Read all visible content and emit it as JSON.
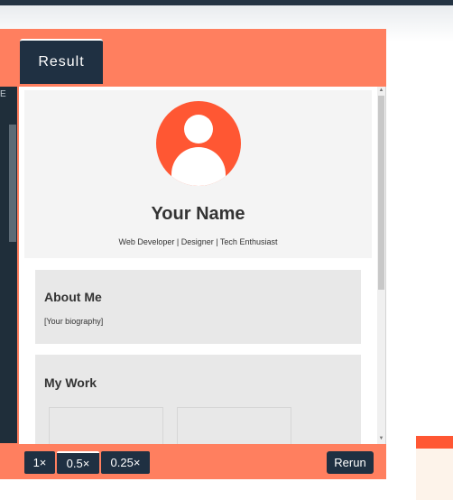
{
  "result_tab": {
    "label": "Result"
  },
  "left_panel": {
    "label": "E"
  },
  "profile": {
    "name": "Your Name",
    "tagline": "Web Developer | Designer | Tech Enthusiast",
    "avatar_icon": "user-icon",
    "accent_color": "#ff5733"
  },
  "about": {
    "title": "About Me",
    "text": "[Your biography]"
  },
  "work": {
    "title": "My Work"
  },
  "zoom": {
    "options": [
      "1×",
      "0.5×",
      "0.25×"
    ],
    "selected": "0.5×"
  },
  "rerun": {
    "label": "Rerun"
  },
  "colors": {
    "panel": "#ff7f5f",
    "dark": "#1f3042"
  }
}
